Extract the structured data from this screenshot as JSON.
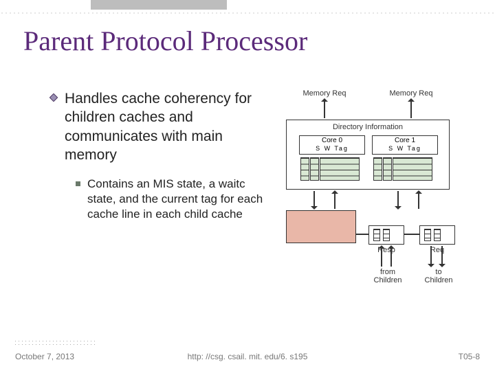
{
  "title": "Parent Protocol Processor",
  "bullets": {
    "b1": "Handles cache coherency for children caches and communicates with main memory",
    "b2": "Contains an MIS state, a waitc state, and the current tag for each cache line in each child cache"
  },
  "diagram": {
    "memreq_l": "Memory Req",
    "memreq_r": "Memory Req",
    "dirinfo": "Directory Information",
    "core0": "Core 0",
    "core1": "Core 1",
    "swt": "S W Tag",
    "resp": "Resp",
    "req": "Req",
    "from": "from\nChildren",
    "to": "to\nChildren"
  },
  "footer": {
    "date": "October 7, 2013",
    "url": "http: //csg. csail. mit. edu/6. s195",
    "page": "T05-8"
  }
}
